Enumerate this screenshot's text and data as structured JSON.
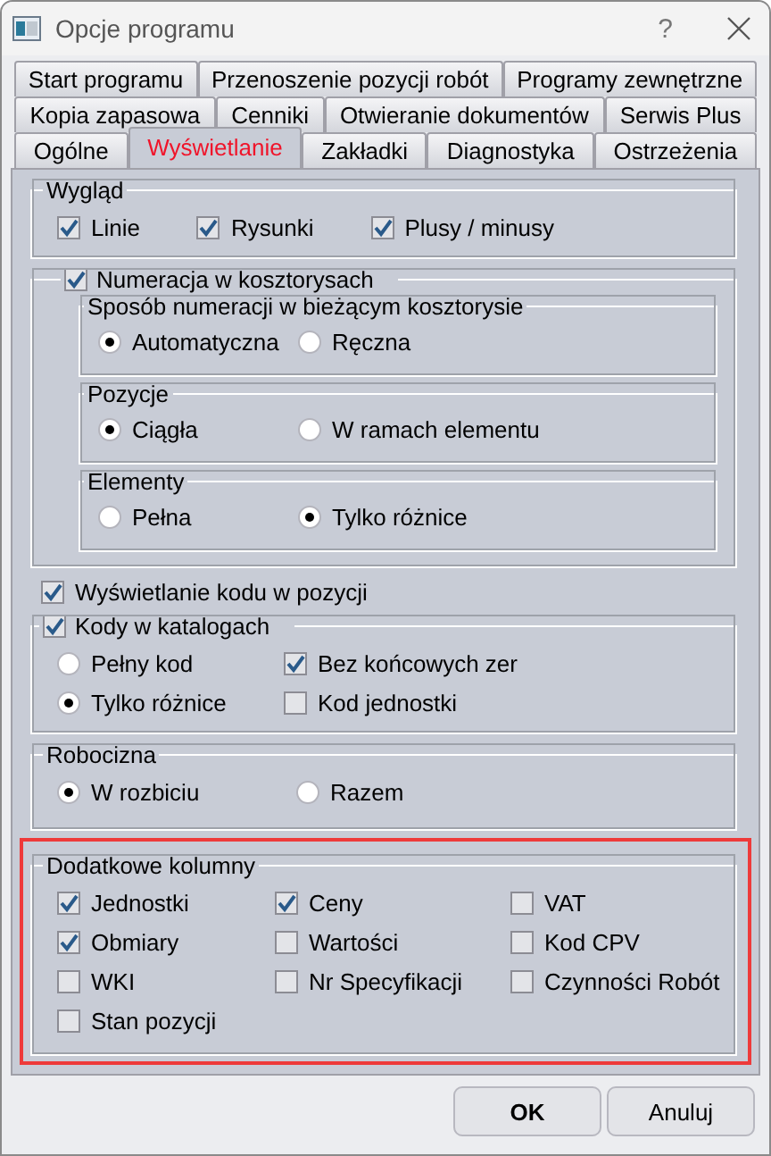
{
  "window": {
    "title": "Opcje programu",
    "help": "?"
  },
  "tab_rows": [
    [
      {
        "label": "Start programu",
        "selected": false
      },
      {
        "label": "Przenoszenie pozycji robót",
        "selected": false
      },
      {
        "label": "Programy zewnętrzne",
        "selected": false
      }
    ],
    [
      {
        "label": "Kopia zapasowa",
        "selected": false
      },
      {
        "label": "Cenniki",
        "selected": false
      },
      {
        "label": "Otwieranie dokumentów",
        "selected": false
      },
      {
        "label": "Serwis Plus",
        "selected": false
      }
    ],
    [
      {
        "label": "Ogólne",
        "selected": false
      },
      {
        "label": "Wyświetlanie",
        "selected": true
      },
      {
        "label": "Zakładki",
        "selected": false
      },
      {
        "label": "Diagnostyka",
        "selected": false
      },
      {
        "label": "Ostrzeżenia",
        "selected": false
      }
    ]
  ],
  "wyglad": {
    "title": "Wygląd",
    "options": [
      {
        "label": "Linie",
        "checked": true
      },
      {
        "label": "Rysunki",
        "checked": true
      },
      {
        "label": "Plusy / minusy",
        "checked": true
      }
    ]
  },
  "numeracja": {
    "label": "Numeracja w kosztorysach",
    "checked": true,
    "groups": [
      {
        "title": "Sposób numeracji w bieżącym kosztorysie",
        "options": [
          {
            "label": "Automatyczna",
            "selected": true
          },
          {
            "label": "Ręczna",
            "selected": false
          }
        ]
      },
      {
        "title": "Pozycje",
        "options": [
          {
            "label": "Ciągła",
            "selected": true
          },
          {
            "label": "W ramach elementu",
            "selected": false
          }
        ]
      },
      {
        "title": "Elementy",
        "options": [
          {
            "label": "Pełna",
            "selected": false
          },
          {
            "label": "Tylko różnice",
            "selected": true
          }
        ]
      }
    ]
  },
  "kod_w_pozycji": {
    "label": "Wyświetlanie kodu w pozycji",
    "checked": true
  },
  "kody": {
    "label": "Kody w katalogach",
    "checked": true,
    "options": [
      {
        "kind": "radio",
        "label": "Pełny kod",
        "on": false
      },
      {
        "kind": "check",
        "label": "Bez końcowych zer",
        "on": true
      },
      {
        "kind": "radio",
        "label": "Tylko różnice",
        "on": true
      },
      {
        "kind": "check",
        "label": "Kod jednostki",
        "on": false
      }
    ]
  },
  "robocizna": {
    "title": "Robocizna",
    "options": [
      {
        "label": "W rozbiciu",
        "selected": true
      },
      {
        "label": "Razem",
        "selected": false
      }
    ]
  },
  "kolumny": {
    "title": "Dodatkowe kolumny",
    "highlighted": true,
    "options": [
      {
        "label": "Jednostki",
        "checked": true
      },
      {
        "label": "Ceny",
        "checked": true
      },
      {
        "label": "VAT",
        "checked": false
      },
      {
        "label": "Obmiary",
        "checked": true
      },
      {
        "label": "Wartości",
        "checked": false
      },
      {
        "label": "Kod CPV",
        "checked": false
      },
      {
        "label": "WKI",
        "checked": false
      },
      {
        "label": "Nr Specyfikacji",
        "checked": false
      },
      {
        "label": "Czynności Robót",
        "checked": false
      },
      {
        "label": "Stan pozycji",
        "checked": false
      }
    ]
  },
  "buttons": [
    {
      "label": "OK",
      "default": true
    },
    {
      "label": "Anuluj",
      "default": false
    }
  ]
}
